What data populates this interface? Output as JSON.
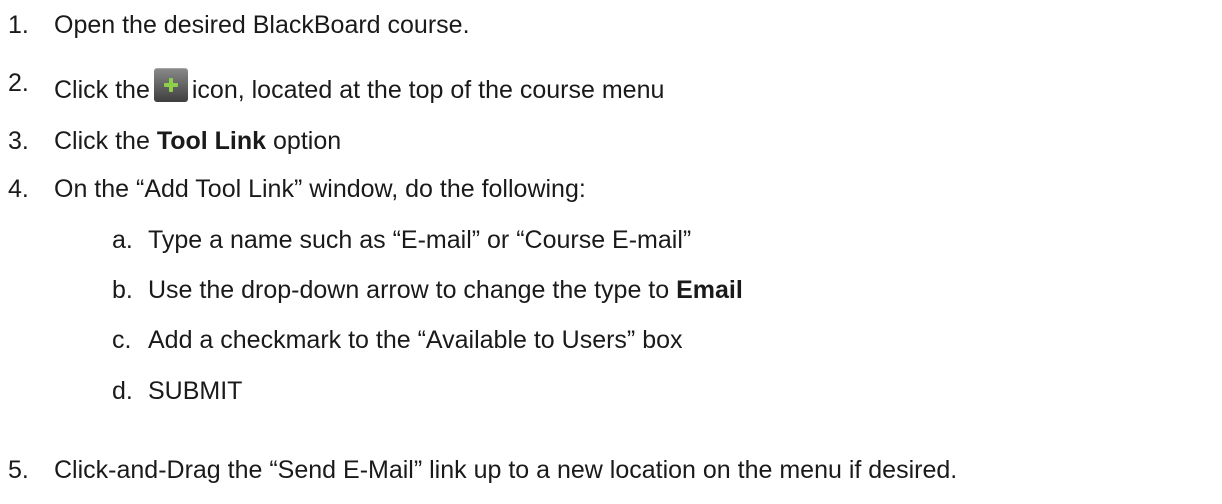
{
  "steps": [
    {
      "num": "1.",
      "text": "Open the desired BlackBoard course."
    },
    {
      "num": "2.",
      "before": "Click the",
      "icon": "plus-icon",
      "after": "icon, located at the top of the course menu"
    },
    {
      "num": "3.",
      "before": "Click the ",
      "bold": "Tool Link",
      "after": " option"
    },
    {
      "num": "4.",
      "text": "On the “Add Tool Link” window, do the following:"
    },
    {
      "num": "5.",
      "text": "Click-and-Drag the “Send E-Mail” link up to a new location on the menu if desired."
    }
  ],
  "substeps": [
    {
      "num": "a.",
      "text": "Type a name such as “E-mail” or “Course E-mail”"
    },
    {
      "num": "b.",
      "before": "Use the drop-down arrow to change the type to ",
      "bold": "Email"
    },
    {
      "num": "c.",
      "text": "Add a checkmark to the “Available to Users” box"
    },
    {
      "num": "d.",
      "text": "SUBMIT"
    }
  ]
}
